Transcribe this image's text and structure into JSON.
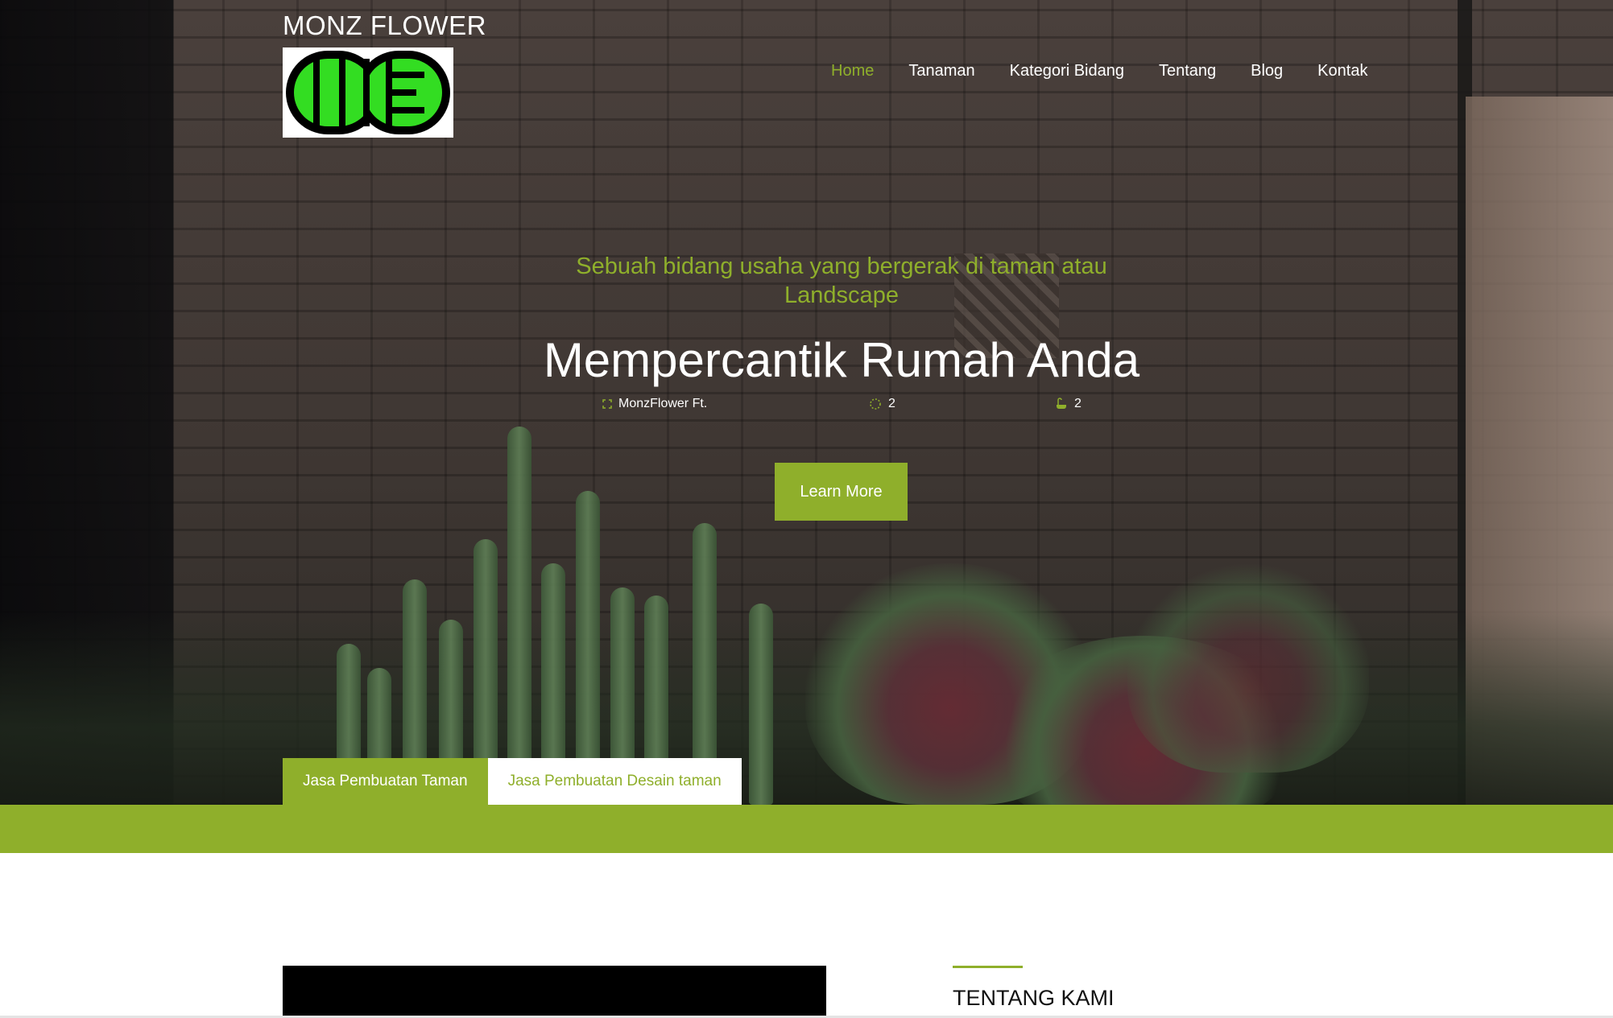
{
  "header": {
    "site_title": "MONZ FLOWER",
    "nav": [
      {
        "label": "Home",
        "active": true
      },
      {
        "label": "Tanaman",
        "active": false
      },
      {
        "label": "Kategori Bidang",
        "active": false
      },
      {
        "label": "Tentang",
        "active": false
      },
      {
        "label": "Blog",
        "active": false
      },
      {
        "label": "Kontak",
        "active": false
      }
    ]
  },
  "hero": {
    "subtitle": "Sebuah bidang usaha yang bergerak di taman atau Landscape",
    "title": "Mempercantik Rumah Anda",
    "meta": [
      {
        "icon": "expand-icon",
        "text": "MonzFlower Ft."
      },
      {
        "icon": "loading-icon",
        "text": "2"
      },
      {
        "icon": "bathtub-icon",
        "text": "2"
      }
    ],
    "cta_label": "Learn More"
  },
  "tabs": [
    {
      "label": "Jasa Pembuatan Taman",
      "active": true
    },
    {
      "label": "Jasa Pembuatan Desain taman",
      "active": false
    }
  ],
  "about": {
    "title": "TENTANG KAMI"
  },
  "colors": {
    "accent": "#8faf2b",
    "text_light": "#ffffff",
    "text_dark": "#111111"
  }
}
